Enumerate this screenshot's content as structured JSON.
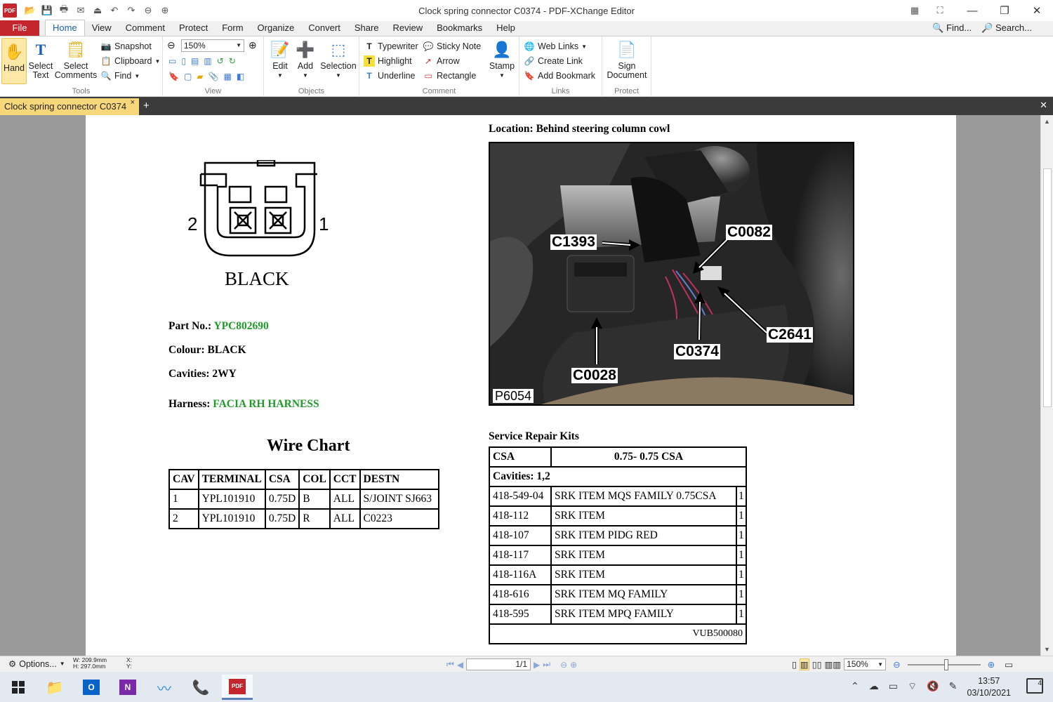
{
  "window": {
    "title": "Clock spring connector C0374 - PDF-XChange Editor",
    "app_logo_text": "PDF"
  },
  "menu": {
    "tabs": [
      "File",
      "Home",
      "View",
      "Comment",
      "Protect",
      "Form",
      "Organize",
      "Convert",
      "Share",
      "Review",
      "Bookmarks",
      "Help"
    ],
    "active_tab": "Home",
    "find_label": "Find...",
    "search_label": "Search..."
  },
  "ribbon": {
    "tools": {
      "label": "Tools",
      "hand": "Hand",
      "select_text": [
        "Select",
        "Text"
      ],
      "select_comments": [
        "Select",
        "Comments"
      ],
      "snapshot": "Snapshot",
      "clipboard": "Clipboard",
      "find": "Find"
    },
    "view": {
      "label": "View",
      "zoom": "150%"
    },
    "objects": {
      "label": "Objects",
      "edit": "Edit",
      "add": "Add",
      "selection": "Selection"
    },
    "comment": {
      "label": "Comment",
      "typewriter": "Typewriter",
      "highlight": "Highlight",
      "underline": "Underline",
      "sticky_note": "Sticky Note",
      "arrow": "Arrow",
      "rectangle": "Rectangle",
      "stamp": "Stamp"
    },
    "links": {
      "label": "Links",
      "web_links": "Web Links",
      "create_link": "Create Link",
      "add_bookmark": "Add Bookmark"
    },
    "protect": {
      "label": "Protect",
      "sign_document": [
        "Sign",
        "Document"
      ]
    }
  },
  "document_tab": {
    "label": "Clock spring connector C0374"
  },
  "page": {
    "location_title": "Location: Behind steering column cowl",
    "photo": {
      "callouts": [
        "C1393",
        "C0082",
        "C2641",
        "C0374",
        "C0028"
      ],
      "code": "P6054"
    },
    "connector": {
      "pin_left": "2",
      "pin_right": "1",
      "colour_label": "BLACK"
    },
    "part_no_label": "Part No.:",
    "part_no_value": "YPC802690",
    "colour_label": "Colour:",
    "colour_value": "BLACK",
    "cavities_label": "Cavities:",
    "cavities_value": "2WY",
    "harness_label": "Harness:",
    "harness_value": "FACIA RH HARNESS",
    "wire_chart": {
      "title": "Wire Chart",
      "headers": [
        "CAV",
        "TERMINAL",
        "CSA",
        "COL",
        "CCT",
        "DESTN"
      ],
      "rows": [
        [
          "1",
          "YPL101910",
          "0.75D",
          "B",
          "ALL",
          "S/JOINT SJ663"
        ],
        [
          "2",
          "YPL101910",
          "0.75D",
          "R",
          "ALL",
          "C0223"
        ]
      ]
    },
    "service_kits": {
      "title": "Service Repair Kits",
      "csa_label": "CSA",
      "csa_value": "0.75- 0.75 CSA",
      "cavities": "Cavities: 1,2",
      "rows": [
        [
          "418-549-04",
          "SRK ITEM MQS FAMILY 0.75CSA",
          "1"
        ],
        [
          "418-112",
          "SRK ITEM",
          "1"
        ],
        [
          "418-107",
          "SRK ITEM PIDG RED",
          "1"
        ],
        [
          "418-117",
          "SRK ITEM",
          "1"
        ],
        [
          "418-116A",
          "SRK ITEM",
          "1"
        ],
        [
          "418-616",
          "SRK ITEM MQ FAMILY",
          "1"
        ],
        [
          "418-595",
          "SRK ITEM MPQ FAMILY",
          "1"
        ]
      ],
      "footer_code": "VUB500080"
    }
  },
  "statusbar": {
    "options": "Options...",
    "dims_w": "W: 209.9mm",
    "dims_h": "H: 297.0mm",
    "coord_x": "X:",
    "coord_y": "Y:",
    "page_indicator": "1/1",
    "zoom": "150%"
  },
  "taskbar": {
    "time": "13:57",
    "date": "03/10/2021",
    "notification_count": "4"
  },
  "colors": {
    "accent_red": "#c4262e",
    "tab_active": "#f7d77a",
    "green_value": "#1e9b29"
  }
}
